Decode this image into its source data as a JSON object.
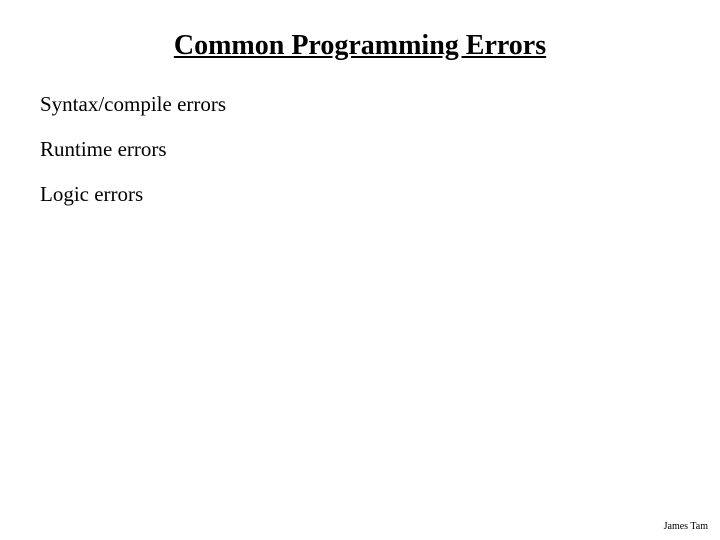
{
  "slide": {
    "title": "Common Programming Errors",
    "bullets": [
      "Syntax/compile errors",
      "Runtime errors",
      "Logic errors"
    ],
    "footer": "James Tam"
  }
}
